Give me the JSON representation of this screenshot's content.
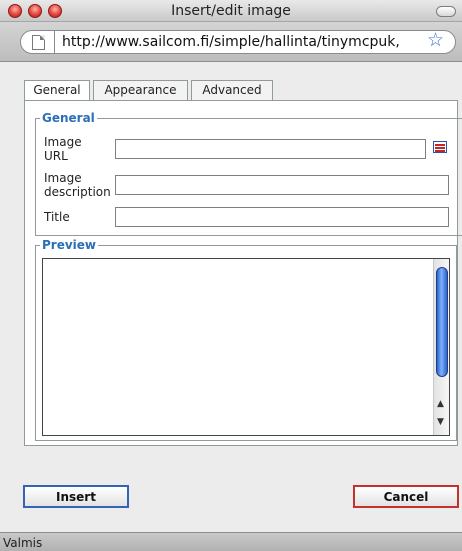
{
  "window": {
    "title": "Insert/edit image"
  },
  "browser": {
    "url": "http://www.sailcom.fi/simple/hallinta/tinymcpuk,"
  },
  "tabs": [
    {
      "label": "General"
    },
    {
      "label": "Appearance"
    },
    {
      "label": "Advanced"
    }
  ],
  "general": {
    "legend": "General",
    "image_url_label": "Image URL",
    "image_url_value": "",
    "image_description_label": "Image description",
    "image_description_value": "",
    "title_label": "Title",
    "title_value": ""
  },
  "preview": {
    "legend": "Preview"
  },
  "buttons": {
    "insert": "Insert",
    "cancel": "Cancel"
  },
  "status": {
    "text": "Valmis"
  },
  "colors": {
    "legend_blue": "#2b6fb6",
    "insert_border": "#3563b7",
    "cancel_border": "#c4312c"
  },
  "icons": {
    "browse": "browse-files-icon",
    "bookmark": "star-icon",
    "page": "page-icon"
  }
}
